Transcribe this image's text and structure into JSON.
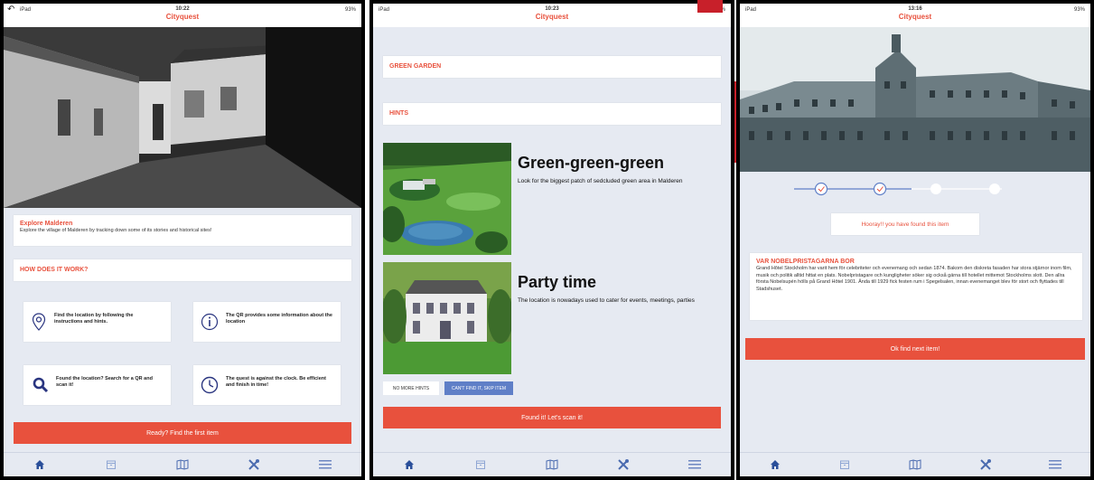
{
  "status": {
    "carrier": "iPad",
    "battery": "93%"
  },
  "screen1": {
    "time": "10:22",
    "app_title": "Cityquest",
    "intro_title": "Explore Malderen",
    "intro_text": "Explore the village of Malderen by tracking down some of its stories and historical sites!",
    "how_title": "HOW DOES IT WORK?",
    "features": [
      {
        "icon": "location-pin-icon",
        "text": "Find the location by following the instructions and hints."
      },
      {
        "icon": "info-icon",
        "text": "The QR provides some information about the location"
      },
      {
        "icon": "search-icon",
        "text": "Found the location? Search for a QR and scan it!"
      },
      {
        "icon": "clock-icon",
        "text": "The quest is against the clock. Be efficient and finish in time!"
      }
    ],
    "cta": "Ready? Find the first item"
  },
  "screen2": {
    "time": "10:23",
    "app_title": "Cityquest",
    "section1": "GREEN GARDEN",
    "section2": "HINTS",
    "hint1_title": "Green-green-green",
    "hint1_text": "Look for the biggest patch of sedcluded green area in Malderen",
    "hint2_title": "Party time",
    "hint2_text": "The location is nowadays used to cater for events, meetings, parties",
    "no_more_hints": "NO MORE HINTS",
    "skip": "CAN'T FIND IT, SKIP ITEM",
    "cta": "Found it! Let's scan it!"
  },
  "screen3": {
    "time": "13:16",
    "app_title": "Cityquest",
    "found_msg": "Hooray!! you have found this item",
    "info_title": "VAR NOBELPRISTAGARNA BOR",
    "info_text": "Grand Hôtel Stockholm har varit hem för celebriteter och evenemang och sedan 1874. Bakom den diskreta fasaden har stora stjärnor inom film, musik och politik alltid hittat en plats. Nobelpristagare och kungligheter söker sig också gärna till hotellet mittemot Stockholms slott. Den allra första Nobelsupén hölls på Grand Hôtel 1901. Ända till 1929 fick festen rum i Spegelsalen, innan evenemanget blev för stort och flyttades till Stadshuset.",
    "cta": "Ok find next item!"
  },
  "tabs": [
    "home-icon",
    "archive-icon",
    "map-icon",
    "tools-icon",
    "menu-icon"
  ],
  "colors": {
    "accent": "#e8513d",
    "background": "#e6eaf2",
    "navy": "#2a3580",
    "tab_icon": "#3a5ca8"
  }
}
